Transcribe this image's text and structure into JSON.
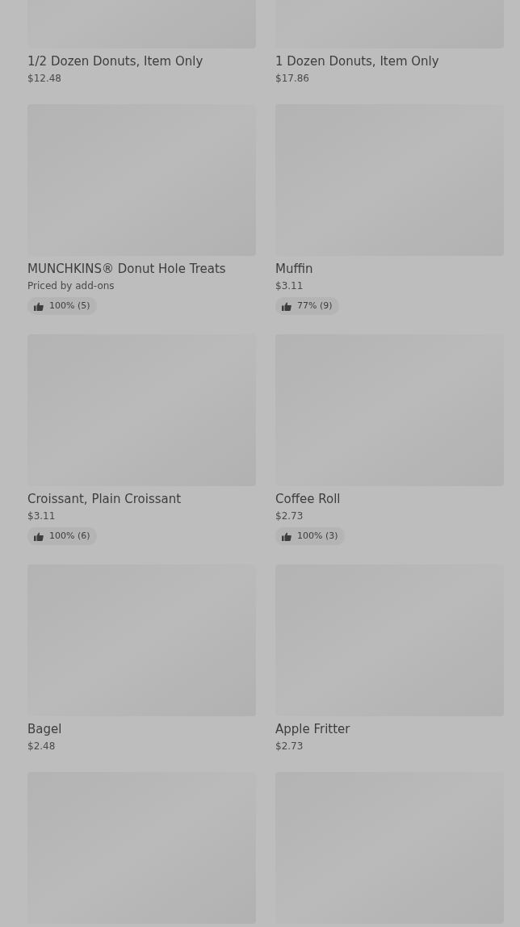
{
  "items": [
    {
      "kind": "product",
      "name": "1/2 Dozen Donuts, Item Only",
      "price": "$12.48"
    },
    {
      "kind": "product",
      "name": "1 Dozen Donuts, Item Only",
      "price": "$17.86"
    },
    {
      "kind": "product",
      "name": "MUNCHKINS® Donut Hole Treats",
      "price": "Priced by add-ons",
      "rating": "100% (5)"
    },
    {
      "kind": "product",
      "name": "Muffin",
      "price": "$3.11",
      "rating": "77% (9)"
    },
    {
      "kind": "product",
      "name": "Croissant, Plain Croissant",
      "price": "$3.11",
      "rating": "100% (6)"
    },
    {
      "kind": "product",
      "name": "Coffee Roll",
      "price": "$2.73",
      "rating": "100% (3)"
    },
    {
      "kind": "product",
      "name": "Bagel",
      "price": "$2.48"
    },
    {
      "kind": "product",
      "name": "Apple Fritter",
      "price": "$2.73"
    },
    {
      "kind": "image_only"
    },
    {
      "kind": "image_only"
    }
  ]
}
